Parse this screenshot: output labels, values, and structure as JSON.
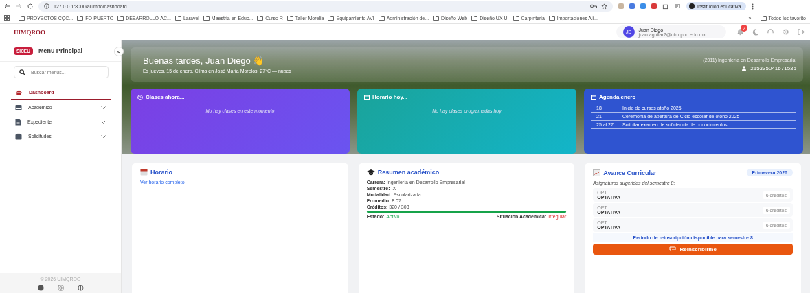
{
  "browser": {
    "url": "127.0.0.1:8000/alumno/dashboard",
    "profile": "Institución educativa",
    "bookmarks": [
      "PROYECTOS CQC...",
      "FO-PUERTO",
      "DESARROLLO-AC...",
      "Laravel",
      "Maestria en Educ...",
      "Curso R",
      "Taller Morelia",
      "Equipamiento AVI",
      "Administración de...",
      "Diseño Web",
      "Diseño UX UI",
      "Carpinteria",
      "Importaciones Ali..."
    ],
    "more": "»",
    "all_bookmarks": "Todos los favorito"
  },
  "header": {
    "logo": "UIMQROO",
    "user_initials": "JD",
    "user_name": "Juan Diego",
    "user_email": "juan.aguilar2@uimqroo.edu.mx",
    "notifications": "2"
  },
  "sidebar": {
    "badge": "SICEU",
    "title": "Menu Principal",
    "collapse": "<",
    "search": {
      "placeholder": "Buscar menús..."
    },
    "items": [
      {
        "label": "Dashboard",
        "kind": "home",
        "selected": true,
        "expandable": false
      },
      {
        "label": "Académico",
        "kind": "book",
        "selected": false,
        "expandable": true
      },
      {
        "label": "Expediente",
        "kind": "file",
        "selected": false,
        "expandable": true
      },
      {
        "label": "Solicitudes",
        "kind": "case",
        "selected": false,
        "expandable": true
      }
    ],
    "footer": "© 2026 UIMQROO"
  },
  "hero": {
    "greeting": "Buenas tardes, Juan Diego 👋",
    "subtitle": "Es jueves, 15 de enero.  Clima en José María Morelos, 27°C — nubes",
    "program": "(2011) Ingeniería en Desarrollo Empresarial",
    "student_id": "215335041671535"
  },
  "panels": [
    {
      "title": "Clases ahora...",
      "kind": "clock",
      "empty": "No hay clases en este momento"
    },
    {
      "title": "Horario hoy...",
      "kind": "calendar",
      "empty": "No hay clases programadas hoy"
    }
  ],
  "agenda": {
    "title": "Agenda enero",
    "events": [
      {
        "date": "18",
        "text": "Inicio de cursos otoño 2025"
      },
      {
        "date": "21",
        "text": "Ceremonia de apertura de Ciclo escolar de otoño 2025"
      },
      {
        "date": "25 al 27",
        "text": "Solicitar examen de suficiencia de conocimientos."
      }
    ]
  },
  "schedule": {
    "title": "Horario",
    "link": "Ver horario completo"
  },
  "summary": {
    "title": "Resumen académico",
    "fields": [
      {
        "label": "Carrera:",
        "value": "Ingeniería en Desarrollo Empresarial"
      },
      {
        "label": "Semestre:",
        "value": "IX"
      },
      {
        "label": "Modalidad:",
        "value": "Escolarizada"
      },
      {
        "label": "Promedio:",
        "value": "8.07"
      },
      {
        "label": "Créditos:",
        "value": "320 / 308"
      }
    ],
    "credits_bar": {
      "level": 1.0
    },
    "status": [
      {
        "label": "Estado:",
        "value": "Activo",
        "kind": "ok"
      },
      {
        "label": "Situación Académica:",
        "value": "Irregular",
        "kind": "alert"
      }
    ]
  },
  "progress": {
    "title": "Avance Curricular",
    "period": "Primavera 2026",
    "subtitle": "Asignaturas sugeridas del semestre 8:",
    "subjects": [
      {
        "code": "OPT",
        "name": "OPTATIVA",
        "credits": "6 créditos"
      },
      {
        "code": "OPT",
        "name": "OPTATIVA",
        "credits": "6 créditos"
      },
      {
        "code": "OPT",
        "name": "OPTATIVA",
        "credits": "6 créditos"
      }
    ],
    "notice": "Periodo de reinscripción disponible para semestre 8",
    "button": "Reinscribirme"
  }
}
